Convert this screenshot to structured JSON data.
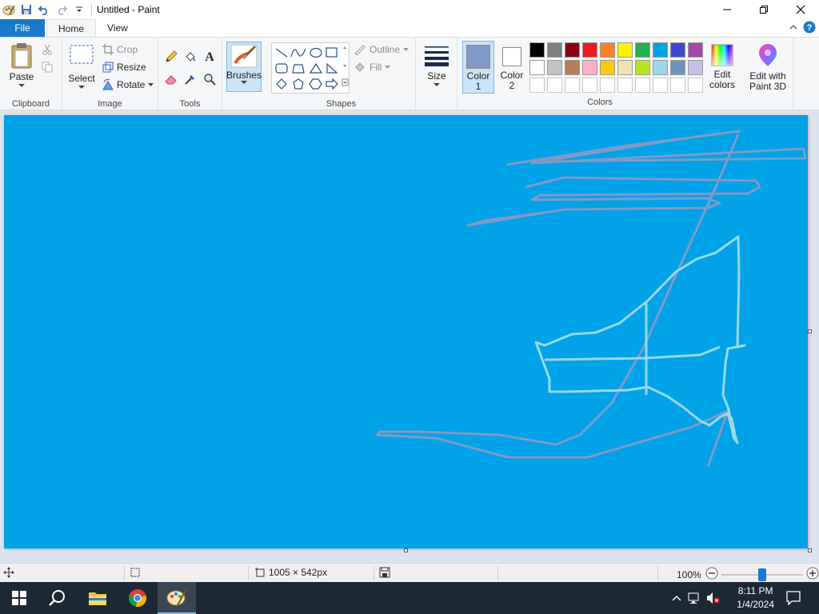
{
  "app": {
    "title": "Untitled - Paint"
  },
  "tabs": {
    "file": "File",
    "home": "Home",
    "view": "View"
  },
  "clipboard": {
    "paste": "Paste",
    "label": "Clipboard",
    "cut_icon": "scissors-icon",
    "copy_icon": "copy-icon"
  },
  "image": {
    "select": "Select",
    "crop": "Crop",
    "resize": "Resize",
    "rotate": "Rotate",
    "label": "Image"
  },
  "tools": {
    "label": "Tools",
    "items": [
      "pencil-icon",
      "fill-icon",
      "text-icon",
      "eraser-icon",
      "color-picker-icon",
      "magnifier-icon"
    ]
  },
  "brushes": {
    "label": "Brushes"
  },
  "shapes": {
    "label": "Shapes",
    "outline": "Outline",
    "fill": "Fill"
  },
  "size": {
    "label": "Size"
  },
  "colors": {
    "label": "Colors",
    "color1_line1": "Color",
    "color1_line2": "1",
    "color2_line1": "Color",
    "color2_line2": "2",
    "color1_value": "#7f9ac9",
    "color2_value": "#ffffff",
    "edit_colors_line1": "Edit",
    "edit_colors_line2": "colors",
    "paint3d_line1": "Edit with",
    "paint3d_line2": "Paint 3D",
    "palette_row1": [
      "#000000",
      "#7f7f7f",
      "#880015",
      "#ed1c24",
      "#ff7f27",
      "#fff200",
      "#22b14c",
      "#00a2e8",
      "#3f48cc",
      "#a349a4"
    ],
    "palette_row2": [
      "#ffffff",
      "#c3c3c3",
      "#b97a57",
      "#ffaec9",
      "#ffc90e",
      "#efe4b0",
      "#b5e61d",
      "#99d9ea",
      "#7092be",
      "#c8bfe7"
    ]
  },
  "canvas": {
    "background": "#00a2e8"
  },
  "status": {
    "dimensions": "1005 × 542px",
    "zoom": "100%",
    "zoom_level": 1.0
  },
  "taskbar": {
    "time": "8:11 PM",
    "date": "1/4/2024"
  }
}
